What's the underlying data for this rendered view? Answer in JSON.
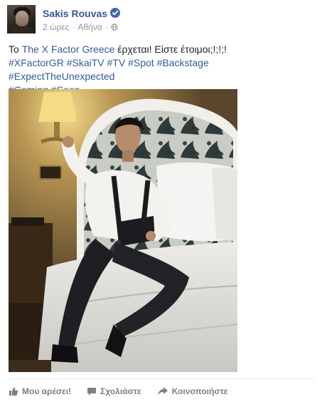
{
  "post": {
    "author": "Sakis Rouvas",
    "time": "2 ώρες",
    "location": "Αθήνα",
    "separator": "·",
    "text_prefix": "Το ",
    "page_link": "The X Factor Greece",
    "text_suffix": " έρχεται! Είστε έτοιμοι;!;!;!",
    "hashtags": [
      "#XFactorGR",
      "#SkaiTV",
      "#TV",
      "#Spot",
      "#Backstage",
      "#ExpectTheUnexpected",
      "#Coming",
      "#Soon"
    ]
  },
  "actions": {
    "like": "Μου αρέσει!",
    "comment": "Σχολιάστε",
    "share": "Κοινοποιήστε"
  },
  "icons": {
    "verified": "verified-badge-icon",
    "privacy": "globe-icon",
    "like": "thumbs-up-icon",
    "comment": "comment-bubble-icon",
    "share": "share-arrow-icon"
  },
  "colors": {
    "link": "#365899",
    "meta": "#90949c",
    "verified": "#4267b2",
    "action": "#7f7f7f"
  }
}
